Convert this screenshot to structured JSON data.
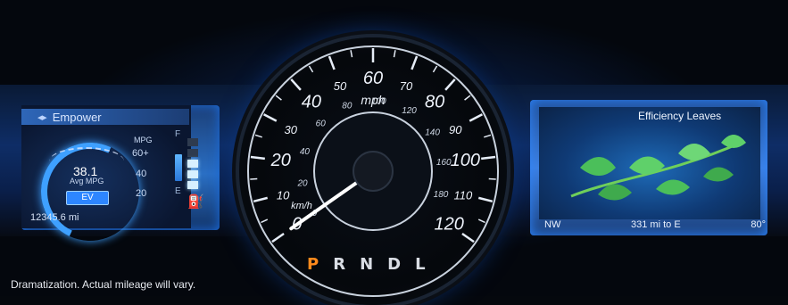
{
  "left_display": {
    "title": "Empower",
    "mpg_unit": "MPG",
    "mpg_ticks": [
      "60+",
      "40",
      "20"
    ],
    "avg_mpg_value": "38.1",
    "avg_mpg_label": "Avg MPG",
    "mode_badge": "EV",
    "odometer": "12345.6 mi",
    "fuel_full_label": "F",
    "fuel_empty_label": "E",
    "icons": [
      "empower-icon",
      "fuel-pump-icon"
    ]
  },
  "speedometer": {
    "mph_label": "mph",
    "kmh_label": "km/h",
    "mph_ticks": [
      "0",
      "10",
      "20",
      "30",
      "40",
      "50",
      "60",
      "70",
      "80",
      "90",
      "100",
      "110",
      "120"
    ],
    "kmh_ticks": [
      "0",
      "20",
      "40",
      "60",
      "80",
      "100",
      "120",
      "140",
      "160",
      "180"
    ],
    "speed_mph": 0
  },
  "gear_selector": {
    "gears": [
      "P",
      "R",
      "N",
      "D",
      "L"
    ],
    "active": "P"
  },
  "right_display": {
    "title": "Efficiency Leaves",
    "compass": "NW",
    "range": "331 mi to E",
    "temperature": "80°"
  },
  "footer": {
    "disclaimer": "Dramatization. Actual mileage will vary."
  },
  "colors": {
    "accent_blue": "#2d86ff",
    "active_gear": "#ff8a1c",
    "leaf_green": "#4bbf5a"
  }
}
